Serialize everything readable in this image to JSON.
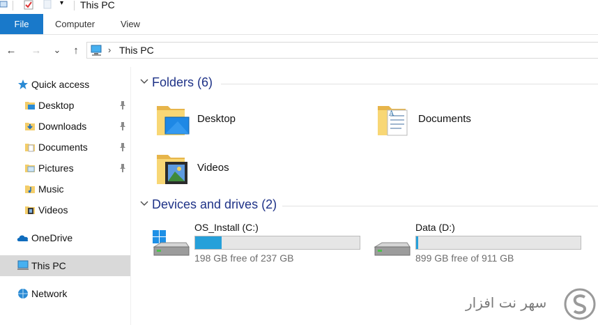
{
  "window": {
    "title": "This PC"
  },
  "ribbon": {
    "tabs": [
      {
        "label": "File",
        "active": true
      },
      {
        "label": "Computer"
      },
      {
        "label": "View"
      }
    ]
  },
  "address": {
    "back": "←",
    "forward": "→",
    "recent": "⌄",
    "up": "↑",
    "separator": "›",
    "location": "This PC"
  },
  "nav_pane": {
    "quick_access": "Quick access",
    "quick_items": [
      {
        "label": "Desktop",
        "pinned": true
      },
      {
        "label": "Downloads",
        "pinned": true
      },
      {
        "label": "Documents",
        "pinned": true
      },
      {
        "label": "Pictures",
        "pinned": true
      },
      {
        "label": "Music",
        "pinned": false
      },
      {
        "label": "Videos",
        "pinned": false
      }
    ],
    "onedrive": "OneDrive",
    "this_pc": "This PC",
    "network": "Network"
  },
  "content": {
    "folders_header": "Folders (6)",
    "folders": [
      {
        "label": "Desktop"
      },
      {
        "label": "Documents"
      },
      {
        "label": "Videos"
      }
    ],
    "drives_header": "Devices and drives (2)",
    "drives": [
      {
        "name": "OS_Install (C:)",
        "free_text": "198 GB free of 237 GB",
        "used_fraction": 0.16
      },
      {
        "name": "Data (D:)",
        "free_text": "899 GB free of 911 GB",
        "used_fraction": 0.013
      }
    ]
  },
  "watermark": {
    "text": "سهر نت افزار"
  },
  "colors": {
    "accent": "#1979ca",
    "header_text": "#1e3287",
    "drive_fill": "#26a0da",
    "selected_bg": "#d9d9d9"
  }
}
